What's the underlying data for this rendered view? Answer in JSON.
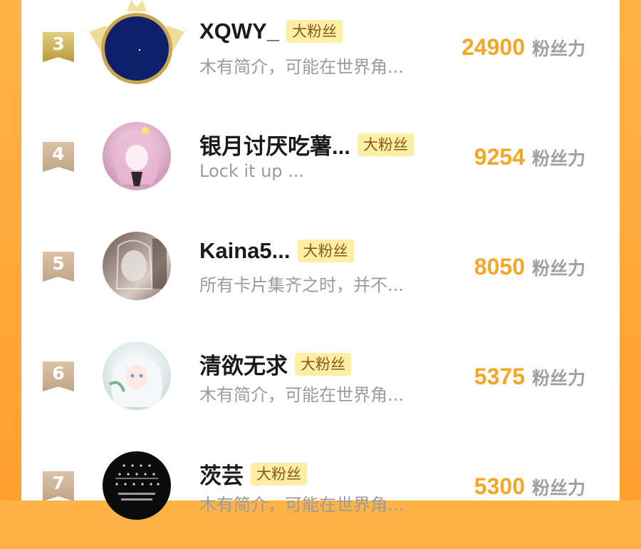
{
  "badge_label": "大粉丝",
  "score_unit": "粉丝力",
  "accent_color": "#f5a623",
  "rows": [
    {
      "rank": "3",
      "name": "XQWY_",
      "bio": "木有简介，可能在世界角...",
      "score": "24900",
      "avatar": "night-sky-avatar"
    },
    {
      "rank": "4",
      "name": "银月讨厌吃薯...",
      "bio": "Lock it up ...",
      "score": "9254",
      "avatar": "anime-girl-pink-avatar"
    },
    {
      "rank": "5",
      "name": "Kaina5...",
      "bio": "所有卡片集齐之时，并不...",
      "score": "8050",
      "avatar": "anime-sketch-avatar"
    },
    {
      "rank": "6",
      "name": "清欲无求",
      "bio": "木有简介，可能在世界角...",
      "score": "5375",
      "avatar": "anime-girl-white-hair-avatar"
    },
    {
      "rank": "7",
      "name": "茨芸",
      "bio": "木有简介，可能在世界角...",
      "score": "5300",
      "avatar": "text-pattern-avatar"
    }
  ]
}
